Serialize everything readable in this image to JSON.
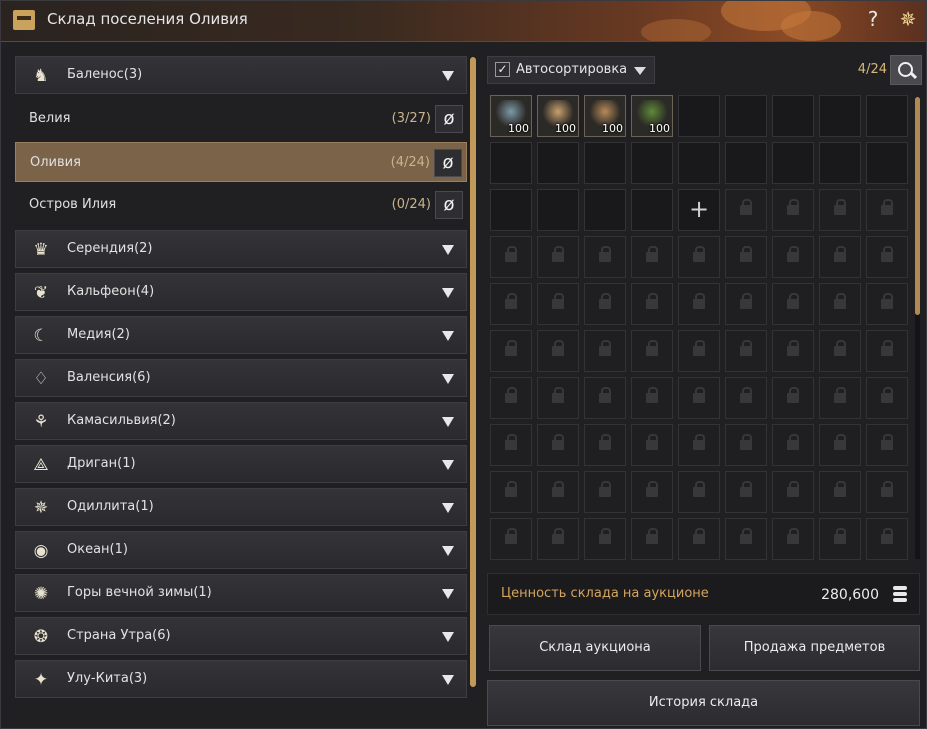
{
  "header": {
    "title": "Склад поселения Оливия",
    "help_icon": "question-mark-icon",
    "help_glyph": "?",
    "settings_icon": "sparkle-gear-icon",
    "settings_glyph": "✵"
  },
  "regions": [
    {
      "label": "Баленос(3)",
      "icon": "horse-icon",
      "glyph": "♞",
      "expanded": true,
      "cities": [
        {
          "label": "Велия",
          "count": "(3/27)",
          "active": false
        },
        {
          "label": "Оливия",
          "count": "(4/24)",
          "active": true
        },
        {
          "label": "Остров Илия",
          "count": "(0/24)",
          "active": false
        }
      ]
    },
    {
      "label": "Серендия(2)",
      "icon": "lion-icon",
      "glyph": "♛"
    },
    {
      "label": "Кальфеон(4)",
      "icon": "eagle-icon",
      "glyph": "❦"
    },
    {
      "label": "Медия(2)",
      "icon": "crescent-icon",
      "glyph": "☾"
    },
    {
      "label": "Валенсия(6)",
      "icon": "diamond-icon",
      "glyph": "♢"
    },
    {
      "label": "Камасильвия(2)",
      "icon": "tree-icon",
      "glyph": "⚘"
    },
    {
      "label": "Дриган(1)",
      "icon": "triangle-emblem-icon",
      "glyph": "⟁"
    },
    {
      "label": "Одиллита(1)",
      "icon": "star-emblem-icon",
      "glyph": "✵"
    },
    {
      "label": "Океан(1)",
      "icon": "globe-icon",
      "glyph": "◉"
    },
    {
      "label": "Горы вечной зимы(1)",
      "icon": "sun-icon",
      "glyph": "✺"
    },
    {
      "label": "Страна Утра(6)",
      "icon": "ornament-icon",
      "glyph": "❂"
    },
    {
      "label": "Улу-Кита(3)",
      "icon": "compass-star-icon",
      "glyph": "✦"
    }
  ],
  "city_button_icon": "transport-icon",
  "city_button_glyph": "ø",
  "toolbar": {
    "autosort_label": "Автосортировка",
    "autosort_checked": true,
    "checkmark": "✓",
    "capacity": "4/24",
    "search_icon": "search-icon"
  },
  "inventory": {
    "columns": 9,
    "rows": 10,
    "items": [
      {
        "name": "water-jug-item",
        "qty": "100",
        "color": "#7d9aa8"
      },
      {
        "name": "potato-item",
        "qty": "100",
        "color": "#c9a070"
      },
      {
        "name": "ore-item",
        "qty": "100",
        "color": "#b88a5a"
      },
      {
        "name": "grass-item",
        "qty": "100",
        "color": "#5e8a3a"
      }
    ],
    "empty_unlocked": 20,
    "plus_glyph": "+"
  },
  "value_bar": {
    "label": "Ценность склада на аукционе",
    "amount": "280,600",
    "icon": "silver-coins-icon"
  },
  "buttons": {
    "auction_storage": "Склад аукциона",
    "sell_items": "Продажа предметов",
    "storage_history": "История склада"
  },
  "colors": {
    "accent": "#d3a55e",
    "active_city": "#7a6348",
    "capacity": "#d8b878"
  }
}
